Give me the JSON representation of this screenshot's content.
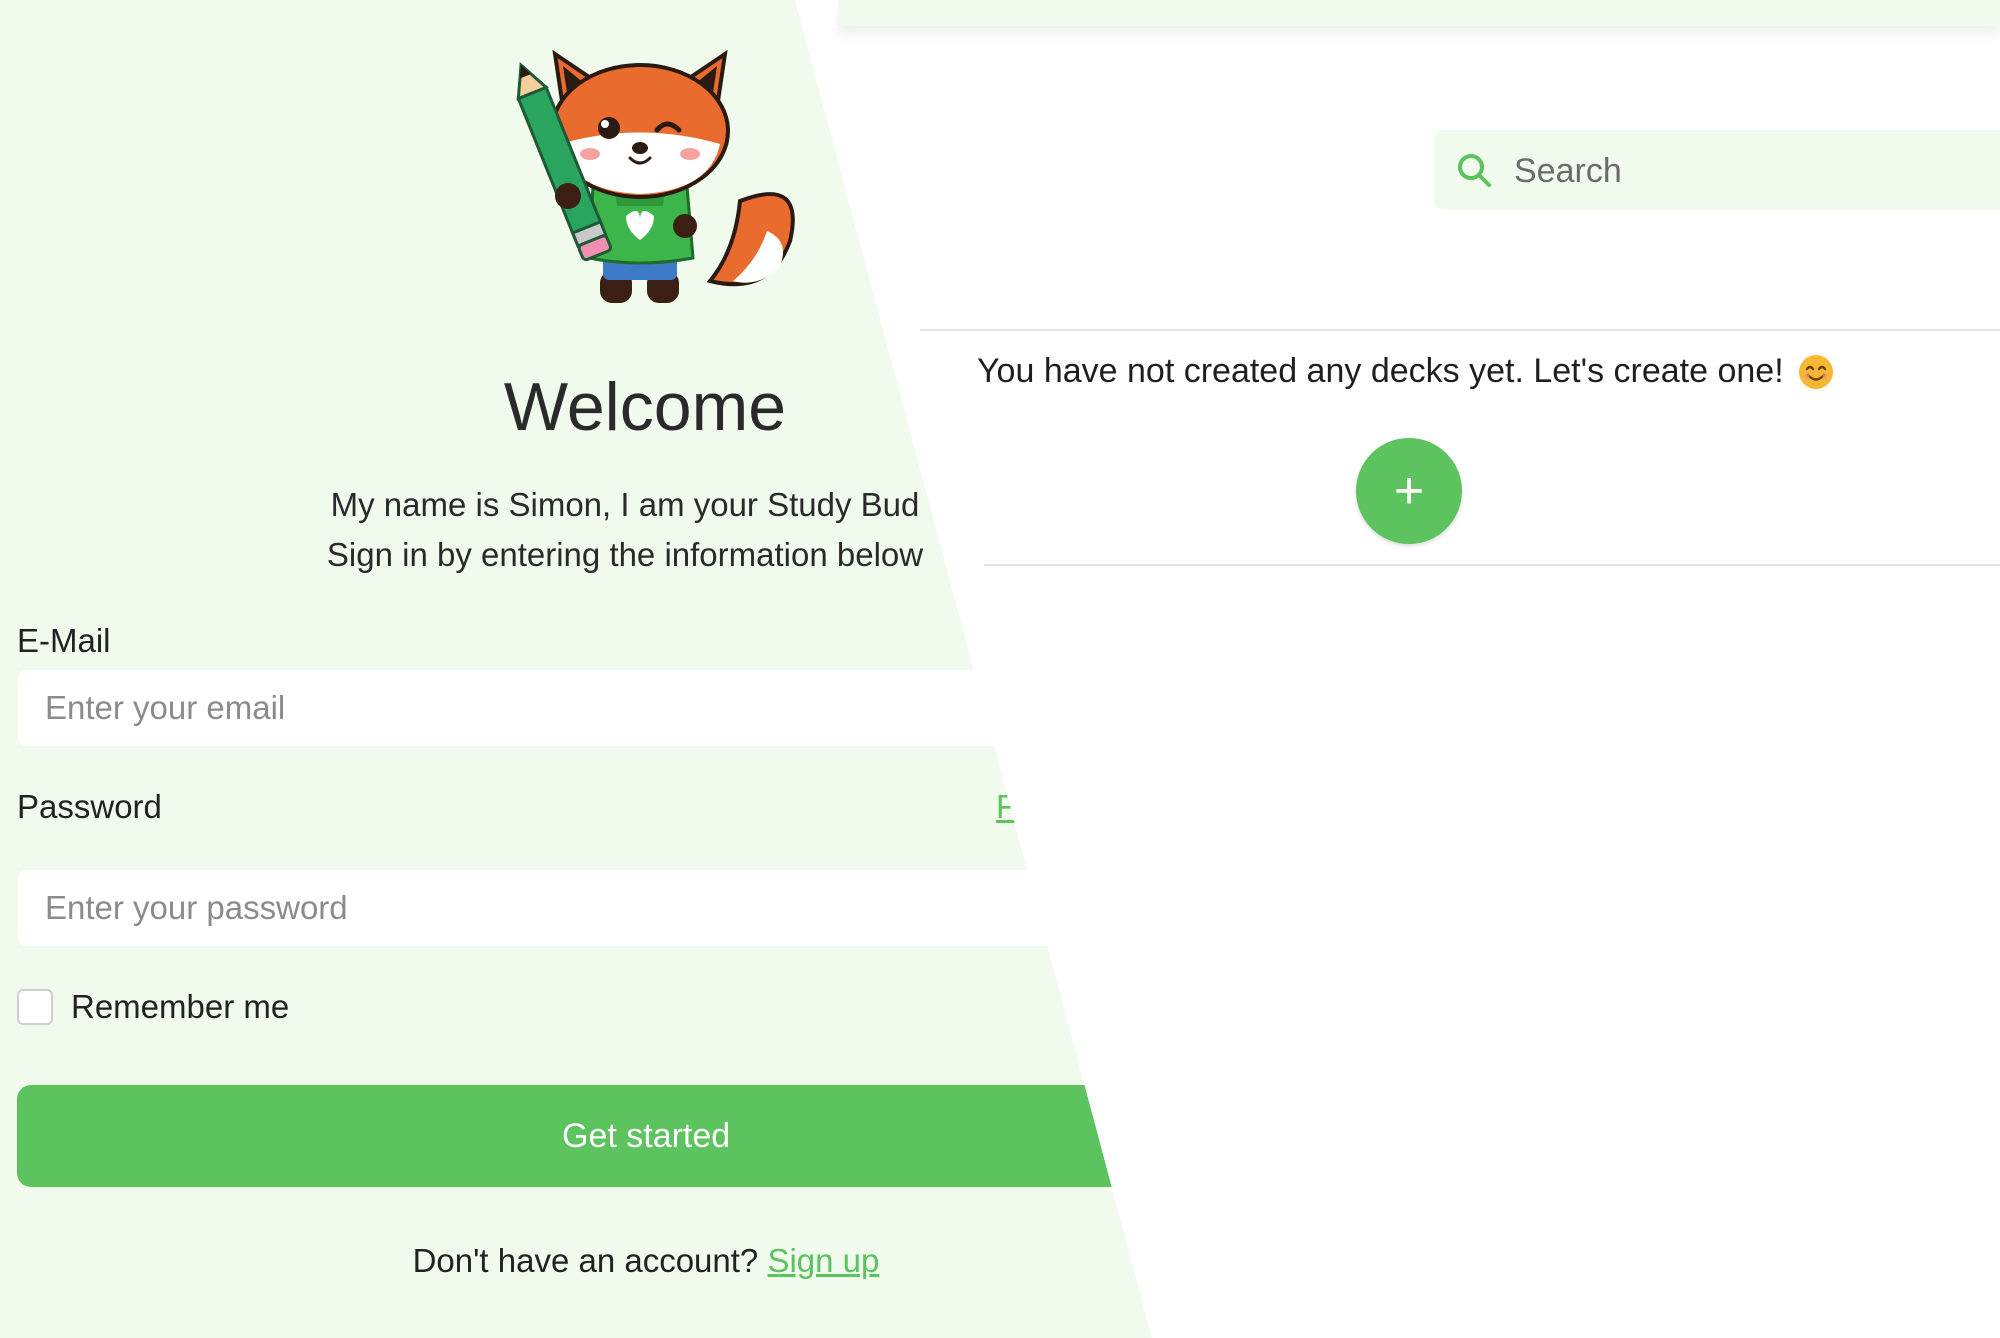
{
  "colors": {
    "accent": "#5cc35f",
    "panel_bg": "#f0fbee",
    "page_bg": "#ffffff"
  },
  "login": {
    "title": "Welcome",
    "intro_line1": "My name is Simon, I am your Study Bud",
    "intro_line2": "Sign in by entering the information below",
    "email_label": "E-Mail",
    "email_placeholder": "Enter your email",
    "password_label": "Password",
    "forgot_link": "F",
    "password_placeholder": "Enter your password",
    "remember_label": "Remember me",
    "submit_label": "Get started",
    "signup_prompt": "Don't have an account?",
    "signup_link": "Sign up",
    "mascot_icon": "fox-mascot-with-pencil"
  },
  "dashboard": {
    "search_placeholder": "Search",
    "empty_message": "You have not created any decks yet. Let's create one!",
    "empty_emoji_icon": "smiling-face-icon",
    "add_button_label": "+"
  }
}
